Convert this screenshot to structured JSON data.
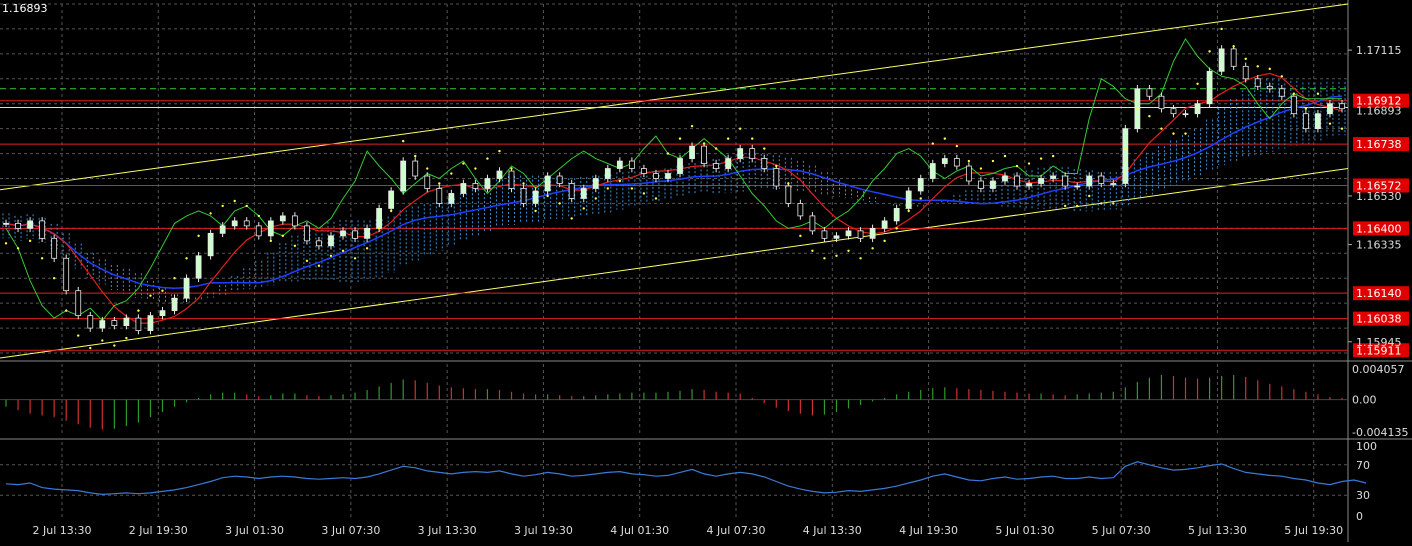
{
  "corner_price": "1.16893",
  "chart_data": [
    {
      "type": "candlestick",
      "panel": "main",
      "ylim": [
        1.1588,
        1.173
      ],
      "price_ticks": [
        "1.17115",
        "1.16530",
        "1.16335",
        "1.15945"
      ],
      "cut_off_tick": "1.16893",
      "red_levels": [
        {
          "value": 1.16912,
          "label": "1.16912"
        },
        {
          "value": 1.16738,
          "label": "1.16738"
        },
        {
          "value": 1.16572,
          "label": "1.16572"
        },
        {
          "value": 1.164,
          "label": "1.16400"
        },
        {
          "value": 1.1614,
          "label": "1.16140"
        },
        {
          "value": 1.16038,
          "label": "1.16038"
        },
        {
          "value": 1.15911,
          "label": "1.15911"
        }
      ],
      "green_dashed_level": 1.1696,
      "white_level": 1.16885,
      "channel_upper": [
        [
          0,
          1.16555
        ],
        [
          111,
          1.173
        ]
      ],
      "channel_lower": [
        [
          0,
          1.1588
        ],
        [
          111,
          1.1664
        ]
      ],
      "candles_close": [
        1.1642,
        1.164,
        1.1643,
        1.1636,
        1.1628,
        1.1615,
        1.1605,
        1.16,
        1.1603,
        1.1601,
        1.1604,
        1.1599,
        1.1605,
        1.1607,
        1.1612,
        1.162,
        1.1629,
        1.1638,
        1.1641,
        1.1643,
        1.1641,
        1.1637,
        1.1643,
        1.1645,
        1.1641,
        1.1635,
        1.1633,
        1.1637,
        1.1639,
        1.1636,
        1.164,
        1.1648,
        1.1655,
        1.1667,
        1.1661,
        1.1656,
        1.165,
        1.1654,
        1.1658,
        1.1656,
        1.166,
        1.1663,
        1.1656,
        1.165,
        1.1655,
        1.1661,
        1.1658,
        1.1652,
        1.1656,
        1.166,
        1.1664,
        1.1667,
        1.1664,
        1.1662,
        1.166,
        1.1662,
        1.1668,
        1.1673,
        1.1666,
        1.1664,
        1.1668,
        1.1672,
        1.1668,
        1.1664,
        1.1657,
        1.165,
        1.1645,
        1.1639,
        1.1636,
        1.1637,
        1.1639,
        1.1636,
        1.164,
        1.1643,
        1.1648,
        1.1655,
        1.166,
        1.1666,
        1.1668,
        1.1665,
        1.1659,
        1.1656,
        1.1659,
        1.1661,
        1.1657,
        1.1658,
        1.166,
        1.1661,
        1.1657,
        1.1657,
        1.1661,
        1.1658,
        1.1658,
        1.168,
        1.1696,
        1.1693,
        1.1688,
        1.1686,
        1.1686,
        1.169,
        1.1703,
        1.1712,
        1.1705,
        1.17,
        1.1697,
        1.1696,
        1.1693,
        1.1686,
        1.168,
        1.1686,
        1.169,
        1.1688
      ],
      "x_tick_labels": [
        "2 Jul 13:30",
        "2 Jul 19:30",
        "3 Jul 01:30",
        "3 Jul 07:30",
        "3 Jul 13:30",
        "3 Jul 19:30",
        "4 Jul 01:30",
        "4 Jul 07:30",
        "4 Jul 13:30",
        "4 Jul 19:30",
        "5 Jul 01:30",
        "5 Jul 07:30",
        "5 Jul 13:30",
        "5 Jul 19:30"
      ],
      "grid": true
    },
    {
      "type": "bar",
      "panel": "oscillator",
      "ylim": [
        -0.004135,
        0.004057
      ],
      "y_tick_labels": [
        "0.004057",
        "0.00",
        "-0.004135"
      ],
      "values": [
        -0.0008,
        -0.0012,
        -0.0016,
        -0.0018,
        -0.002,
        -0.0024,
        -0.0028,
        -0.0032,
        -0.0034,
        -0.0033,
        -0.003,
        -0.0026,
        -0.002,
        -0.0014,
        -0.0008,
        -0.0003,
        0.0002,
        0.0006,
        0.0008,
        0.0008,
        0.0006,
        0.0004,
        0.0005,
        0.0007,
        0.0007,
        0.0005,
        0.0004,
        0.0005,
        0.0006,
        0.0008,
        0.0011,
        0.0015,
        0.0019,
        0.0023,
        0.0022,
        0.0019,
        0.0016,
        0.0014,
        0.0013,
        0.0012,
        0.0012,
        0.0011,
        0.0009,
        0.0007,
        0.0006,
        0.0006,
        0.0005,
        0.0004,
        0.0004,
        0.0005,
        0.0006,
        0.0007,
        0.0008,
        0.0008,
        0.0008,
        0.0009,
        0.001,
        0.0012,
        0.0011,
        0.0009,
        0.0008,
        0.0007,
        0.0002,
        -0.0004,
        -0.0009,
        -0.0013,
        -0.0016,
        -0.0018,
        -0.0017,
        -0.0014,
        -0.001,
        -0.0006,
        -0.0002,
        0.0002,
        0.0006,
        0.0009,
        0.0011,
        0.0013,
        0.0014,
        0.0013,
        0.0012,
        0.0011,
        0.001,
        0.0009,
        0.0008,
        0.0007,
        0.0007,
        0.0006,
        0.0005,
        0.0006,
        0.0007,
        0.0008,
        0.0009,
        0.0014,
        0.002,
        0.0025,
        0.0028,
        0.0027,
        0.0025,
        0.0024,
        0.0025,
        0.0027,
        0.0028,
        0.0026,
        0.0022,
        0.0018,
        0.0015,
        0.0012,
        0.0009,
        0.0006,
        0.0003,
        0.0002,
        0.0001
      ]
    },
    {
      "type": "line",
      "panel": "rsi",
      "ylim": [
        0,
        100
      ],
      "y_tick_labels": [
        "100",
        "70",
        "30",
        "0"
      ],
      "levels": [
        70,
        30
      ],
      "values": [
        45,
        44,
        46,
        40,
        38,
        37,
        36,
        33,
        31,
        32,
        33,
        32,
        33,
        35,
        37,
        40,
        44,
        48,
        53,
        55,
        54,
        52,
        54,
        55,
        54,
        52,
        51,
        52,
        53,
        52,
        54,
        58,
        63,
        68,
        66,
        62,
        60,
        58,
        60,
        61,
        60,
        62,
        58,
        55,
        57,
        60,
        58,
        55,
        56,
        58,
        60,
        61,
        58,
        57,
        55,
        56,
        60,
        64,
        58,
        55,
        58,
        60,
        58,
        54,
        48,
        42,
        38,
        35,
        33,
        34,
        36,
        35,
        37,
        39,
        42,
        46,
        50,
        55,
        58,
        54,
        50,
        49,
        52,
        54,
        51,
        52,
        54,
        55,
        52,
        52,
        54,
        52,
        53,
        68,
        74,
        70,
        66,
        63,
        64,
        66,
        69,
        71,
        65,
        60,
        58,
        56,
        55,
        52,
        50,
        46,
        44,
        48,
        50,
        46
      ]
    }
  ]
}
